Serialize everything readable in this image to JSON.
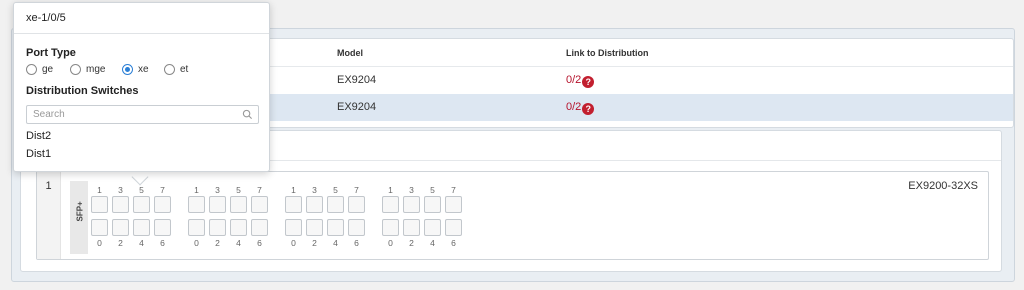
{
  "table": {
    "headers": {
      "model": "Model",
      "link": "Link to Distribution"
    },
    "rows": [
      {
        "model": "EX9204",
        "link": "0/2",
        "badge": "?"
      },
      {
        "model": "EX9204",
        "link": "0/2",
        "badge": "?"
      }
    ]
  },
  "chassis": {
    "slot": "1",
    "model": "EX9200-32XS",
    "group_label": "SFP+",
    "top_numbers": [
      "1",
      "3",
      "5",
      "7"
    ],
    "bottom_numbers": [
      "0",
      "2",
      "4",
      "6"
    ]
  },
  "popover": {
    "title": "xe-1/0/5",
    "port_type_label": "Port Type",
    "port_types": [
      "ge",
      "mge",
      "xe",
      "et"
    ],
    "selected_port_type": "xe",
    "dist_label": "Distribution Switches",
    "search_placeholder": "Search",
    "dist_items": [
      "Dist2",
      "Dist1"
    ]
  },
  "colors": {
    "accent": "#2b7fd6",
    "error": "#c21f2f",
    "selected_row": "#dde7f2"
  }
}
